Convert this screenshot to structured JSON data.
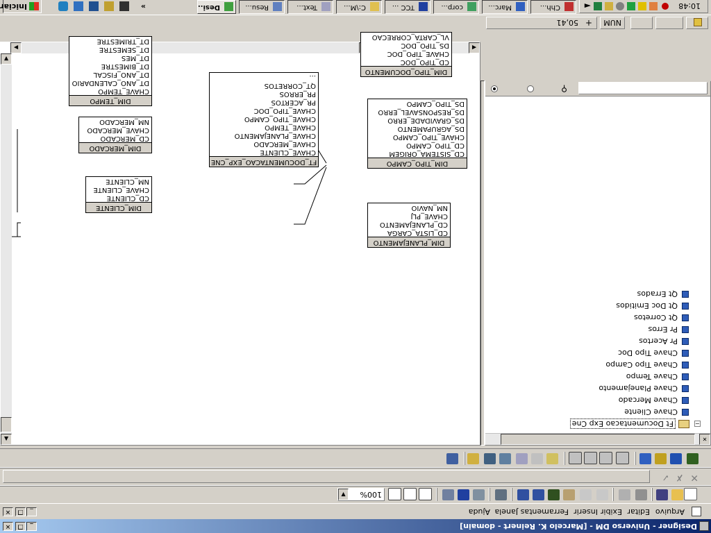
{
  "window": {
    "title": "Designer - Universo DM - [Marcelo K. Reinert - domain]"
  },
  "menu": [
    "Arquivo",
    "Editar",
    "Exibir",
    "Inserir",
    "Ferramentas",
    "Janela",
    "Ajuda"
  ],
  "toolbar": {
    "zoom": "100%"
  },
  "tree": {
    "root": "Ft Documentacao Exp Cne",
    "items": [
      "Chave Cliente",
      "Chave Mercado",
      "Chave Planejamento",
      "Chave Tempo",
      "Chave Tipo Campo",
      "Chave Tipo Doc",
      "Pr Acertos",
      "Pr Erros",
      "Qt Corretos",
      "Qt Doc Emitidos",
      "Qt Errados"
    ]
  },
  "diagram": {
    "tables": [
      {
        "id": "tempo",
        "name": "DIM_TEMPO",
        "columns": [
          "CHAVE_TEMPO",
          "DT_ANO_CALENDARIO",
          "DT_ANO_FISCAL",
          "DT_BIMESTRE",
          "DT_MES",
          "DT_SEMESTRE",
          "DT_TRIMESTRE"
        ]
      },
      {
        "id": "mercado",
        "name": "DIM_MERCADO",
        "columns": [
          "CD_MERCADO",
          "CHAVE_MERCADO",
          "NM_MERCADO"
        ]
      },
      {
        "id": "cliente",
        "name": "DIM_CLIENTE",
        "columns": [
          "CD_CLIENTE",
          "CHAVE_CLIENTE",
          "NM_CLIENTE"
        ]
      },
      {
        "id": "fato",
        "name": "FT_DOCUMENTACAO_EXP_CNE",
        "columns": [
          "CHAVE_CLIENTE",
          "CHAVE_MERCADO",
          "CHAVE_PLANEJAMENTO",
          "CHAVE_TEMPO",
          "CHAVE_TIPO_CAMPO",
          "CHAVE_TIPO_DOC",
          "PR_ACERTOS",
          "PR_ERROS",
          "QT_CORRETOS",
          "..."
        ]
      },
      {
        "id": "tipodoc",
        "name": "DIM_TIPO_DOCUMENTO",
        "columns": [
          "CD_TIPO_DOC",
          "CHAVE_TIPO_DOC",
          "DS_TIPO_DOC",
          "VL_CARTA_CORRECAO"
        ]
      },
      {
        "id": "tipocampo",
        "name": "DIM_TIPO_CAMPO",
        "columns": [
          "CD_SISTEMA_ORIGEM",
          "CD_TIPO_CAMPO",
          "CHAVE_TIPO_CAMPO",
          "DS_AGRUPAMENTO",
          "DS_GRAVIDADE_ERRO",
          "DS_RESPONSAVEL_ERRO",
          "DS_TIPO_CAMPO"
        ]
      },
      {
        "id": "planej",
        "name": "DIM_PLANEJAMENTO",
        "columns": [
          "CD_LISTA_CARGA",
          "CD_PLANEJAMENTO",
          "CHAVE_PLJ",
          "NM_NAVIO"
        ]
      }
    ]
  },
  "status": {
    "coords": "50,41",
    "num": "NUM"
  },
  "taskbar": {
    "start": "Iniciar",
    "tasks": [
      "Desi...",
      "Resu...",
      "Text...",
      "C:\\M...",
      "TCC ...",
      "corp...",
      "Marc...",
      "Chh..."
    ],
    "clock": "10:48"
  }
}
